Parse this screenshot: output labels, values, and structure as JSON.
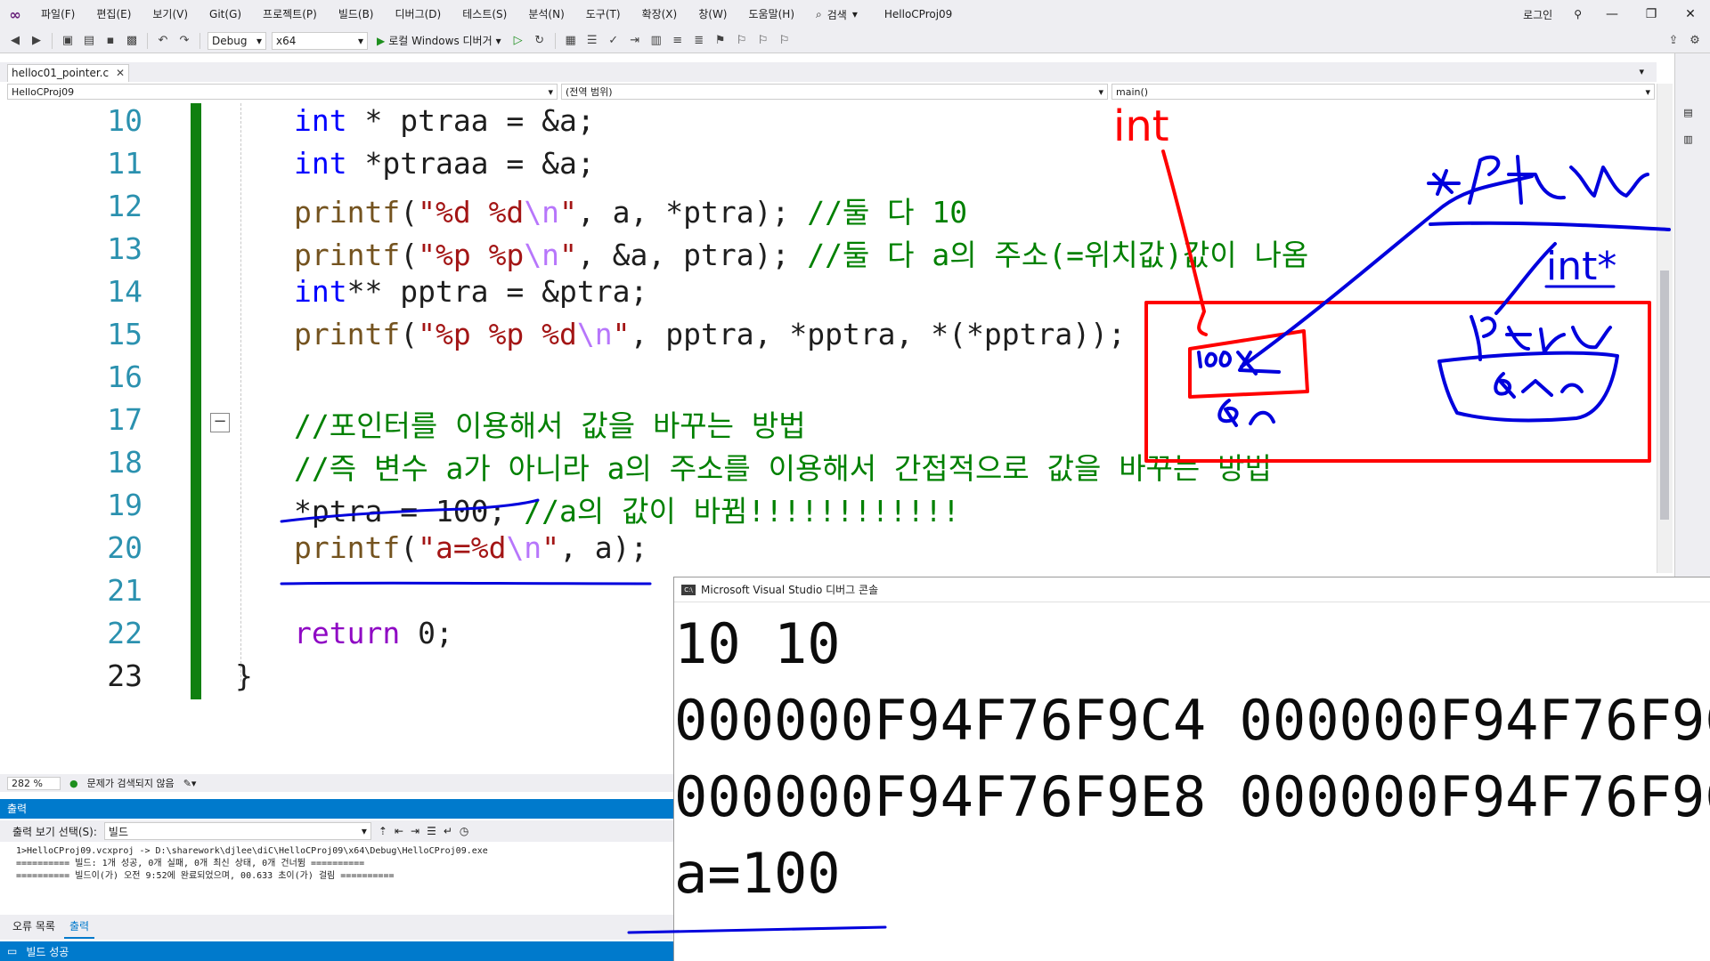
{
  "menubar": {
    "items": [
      "파일(F)",
      "편집(E)",
      "보기(V)",
      "Git(G)",
      "프로젝트(P)",
      "빌드(B)",
      "디버그(D)",
      "테스트(S)",
      "분석(N)",
      "도구(T)",
      "확장(X)",
      "창(W)",
      "도움말(H)"
    ],
    "search_label": "검색",
    "project_title": "HelloCProj09",
    "login_label": "로그인"
  },
  "toolbar": {
    "config": "Debug",
    "platform": "x64",
    "run_label": "로컬 Windows 디버거"
  },
  "editor": {
    "tab_label": "helloc01_pointer.c",
    "nav_project": "HelloCProj09",
    "nav_scope": "(전역 범위)",
    "nav_member": "main()",
    "line_numbers": [
      "10",
      "11",
      "12",
      "13",
      "14",
      "15",
      "16",
      "17",
      "18",
      "19",
      "20",
      "21",
      "22",
      "23"
    ],
    "code": {
      "l10_kw": "int",
      "l10_rest": " * ptraa = &a;",
      "l11_kw": "int",
      "l11_rest": " *ptraaa = &a;",
      "l12_fn": "printf",
      "l12_p1": "(",
      "l12_str": "\"%d %d",
      "l12_esc": "\\n",
      "l12_str2": "\"",
      "l12_rest": ", a, *ptra); ",
      "l12_cmt": "//둘 다 10",
      "l13_fn": "printf",
      "l13_p1": "(",
      "l13_str": "\"%p %p",
      "l13_esc": "\\n",
      "l13_str2": "\"",
      "l13_rest": ", &a, ptra); ",
      "l13_cmt": "//둘 다 a의 주소(=위치값)값이 나옴",
      "l14_kw": "int",
      "l14_rest": "** pptra = &ptra;",
      "l15_fn": "printf",
      "l15_p1": "(",
      "l15_str": "\"%p %p %d",
      "l15_esc": "\\n",
      "l15_str2": "\"",
      "l15_rest": ", pptra, *pptra, *(*pptra));",
      "l17_cmt": "//포인터를 이용해서 값을 바꾸는 방법",
      "l18_cmt": "//즉 변수 a가 아니라 a의 주소를 이용해서 간접적으로 값을 바꾸는 방법",
      "l19_rest": "*ptra = 100; ",
      "l19_cmt": "//a의 값이 바뀜!!!!!!!!!!!!",
      "l20_fn": "printf",
      "l20_p1": "(",
      "l20_str": "\"a=%d",
      "l20_esc": "\\n",
      "l20_str2": "\"",
      "l20_rest": ", a);",
      "l22_kw": "return",
      "l22_rest": " 0;",
      "l23_rest": "}"
    },
    "zoom": "282 %",
    "issues": "문제가 검색되지 않음"
  },
  "output": {
    "header": "출력",
    "source_label": "출력 보기 선택(S):",
    "source_value": "빌드",
    "lines": [
      "1>HelloCProj09.vcxproj -> D:\\sharework\\djlee\\diC\\HelloCProj09\\x64\\Debug\\HelloCProj09.exe",
      "========== 빌드: 1개 성공, 0개 실패, 0개 최신 상태, 0개 건너뜀 ==========",
      "========== 빌드이(가) 오전 9:52에 완료되었으며, 00.633 초이(가) 걸림 =========="
    ],
    "tab_errors": "오류 목록",
    "tab_output": "출력"
  },
  "statusbar": {
    "text": "빌드 성공"
  },
  "console": {
    "title": "Microsoft Visual Studio 디버그 콘솔",
    "lines": [
      "10 10",
      "000000F94F76F9C4 000000F94F76F9C",
      "000000F94F76F9E8 000000F94F76F9C",
      "a=100"
    ]
  },
  "annotations": {
    "red_label": "int",
    "blue_label": "int*"
  },
  "colors": {
    "accent": "#007acc",
    "change_bar": "#108010",
    "ink_red": "#ff0000",
    "ink_blue": "#0000dd"
  }
}
